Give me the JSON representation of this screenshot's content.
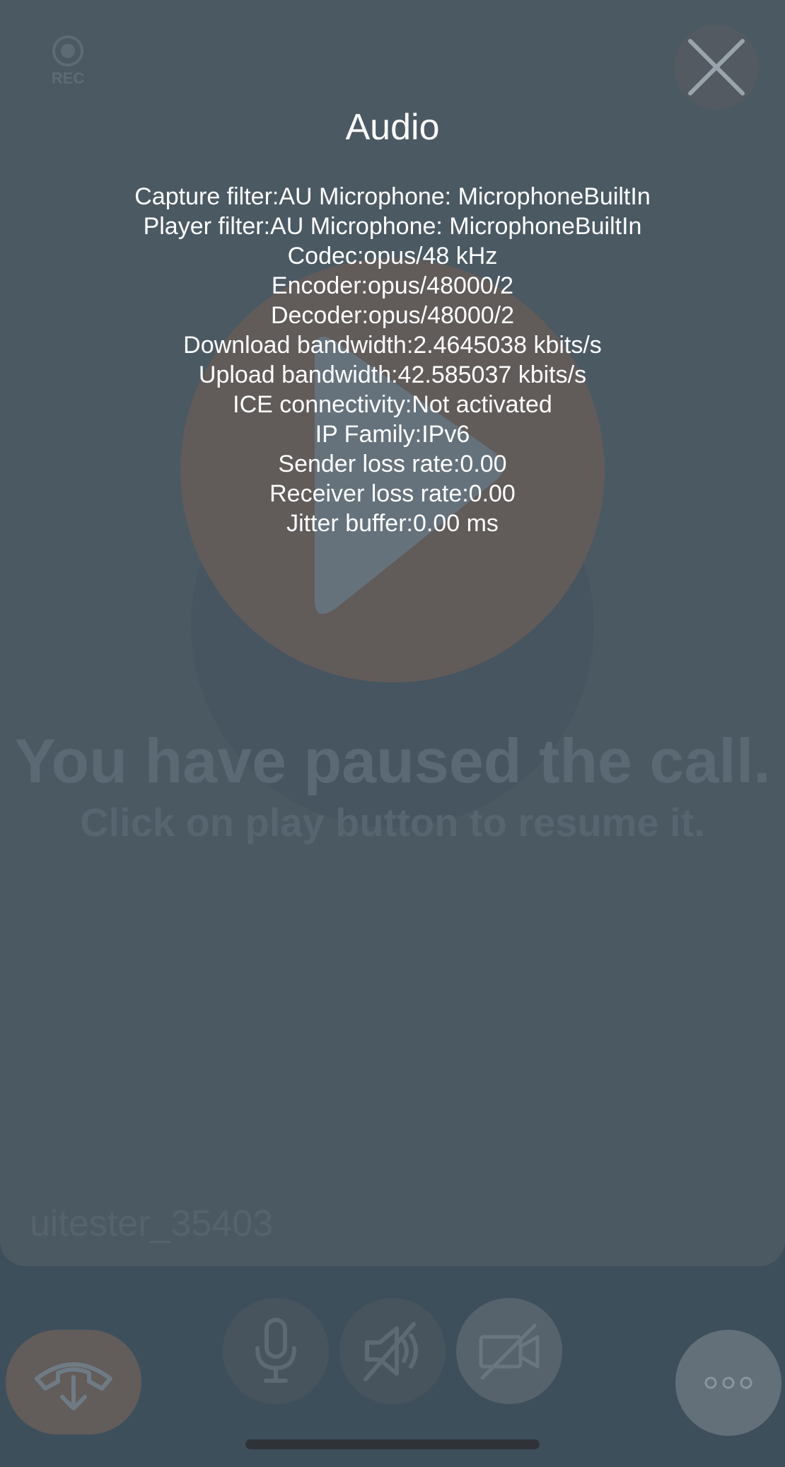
{
  "call": {
    "rec_label": "REC",
    "paused_title": "You have paused the call.",
    "paused_subtitle": "Click on play button to resume it.",
    "participant_name": "uitester_35403"
  },
  "audio_stats": {
    "title": "Audio",
    "lines": [
      "Capture filter:AU Microphone: MicrophoneBuiltIn",
      "Player filter:AU Microphone: MicrophoneBuiltIn",
      "Codec:opus/48 kHz",
      "Encoder:opus/48000/2",
      "Decoder:opus/48000/2",
      "Download bandwidth:2.4645038 kbits/s",
      "Upload bandwidth:42.585037 kbits/s",
      "ICE connectivity:Not activated",
      "IP Family:IPv6",
      "Sender loss rate:0.00",
      "Receiver loss rate:0.00",
      "Jitter buffer:0.00 ms"
    ]
  },
  "controls": {
    "icons": [
      "hang-up-icon",
      "microphone-icon",
      "speaker-muted-icon",
      "camera-off-icon",
      "more-icon"
    ]
  },
  "colors": {
    "overlay_background": "#4b5963",
    "hangup_button": "#625c5b",
    "text": "#ffffff"
  }
}
